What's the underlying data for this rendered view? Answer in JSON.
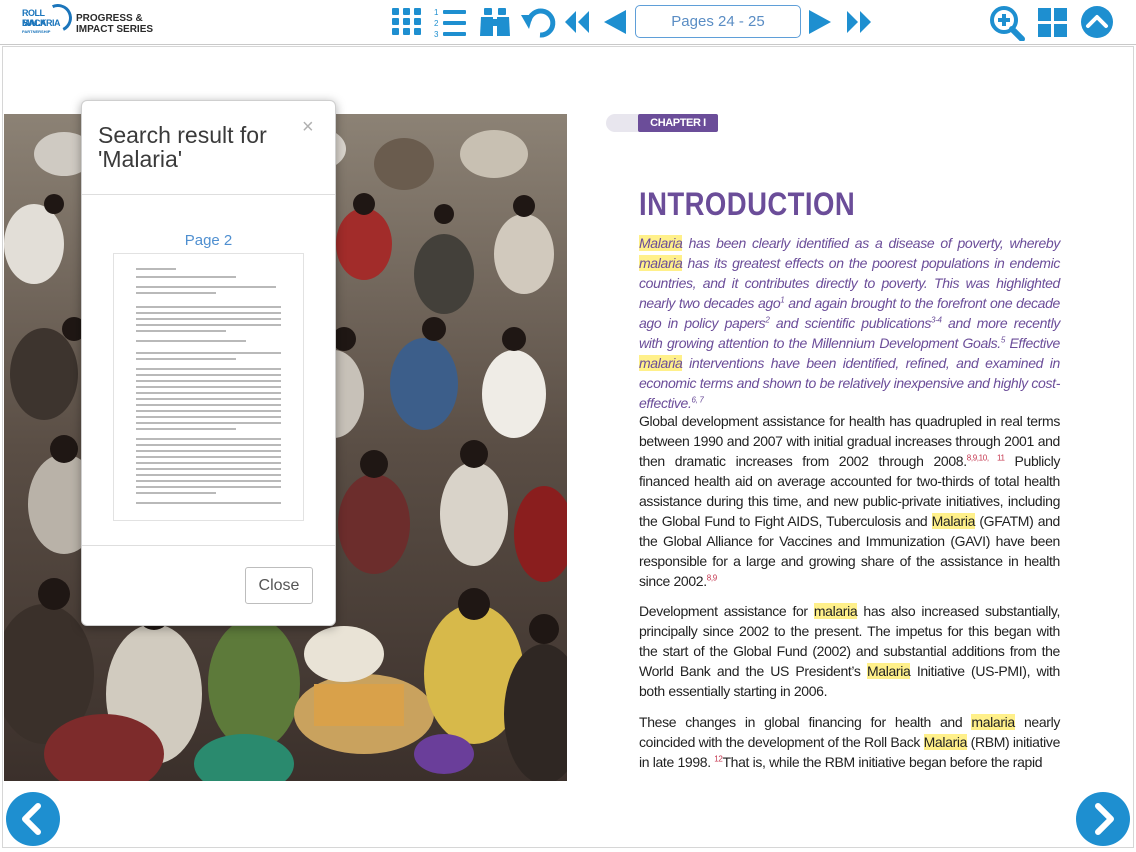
{
  "toolbar": {
    "logo_line1": "ROLL BACK",
    "logo_line2": "MALARIA",
    "logo_line3": "PARTNERSHIP",
    "series_title_1": "PROGRESS &",
    "series_title_2": "IMPACT SERIES",
    "page_indicator": "Pages 24 - 25",
    "icon_color": "#1e8fd0"
  },
  "search_popup": {
    "title": "Search result for 'Malaria'",
    "close_symbol": "×",
    "result_page": "Page 2",
    "close_button": "Close"
  },
  "page": {
    "chapter_label": "CHAPTER I",
    "heading": "INTRODUCTION",
    "accent_color": "#6b4d99",
    "highlight_color": "#fff08a"
  },
  "intro_italic": {
    "t1": "Malaria",
    "t2": " has been clearly identified as a disease of poverty, whereby ",
    "t3": "malaria",
    "t4": " has its greatest effects on the poorest populations in endemic countries, and it contributes directly to poverty. This was highlighted nearly two decades ago",
    "r1": "1",
    "t5": " and again brought to the forefront one decade ago in policy papers",
    "r2": "2",
    "t6": " and scientific publications",
    "r3": "3-4",
    "t7": " and more recently with growing attention to the Millennium Development Goals.",
    "r4": "5",
    "t8": " Effective ",
    "t9": "malaria",
    "t10": " interventions have been identified, refined, and examined in economic terms and shown to be relatively inexpensive and highly cost-effective.",
    "r5": "6, 7"
  },
  "para1": {
    "t1": "Global development assistance for health has quadrupled in real terms between 1990 and 2007 with initial gradual increases through 2001 and then dramatic increases from 2002 through 2008.",
    "r1": "8,9,10, 11",
    "t2": " Publicly financed health aid on average accounted for two-thirds of total health assistance during this time, and new public-private initiatives, including the Global Fund to Fight AIDS, Tuberculosis and ",
    "t3": "Malaria",
    "t4": " (GFATM) and the Global Alliance for Vaccines and Immunization (GAVI) have been responsible for a large and growing share of the assistance in health since 2002.",
    "r2": "8,9"
  },
  "para2": {
    "t1": "Development assistance for ",
    "t2": "malaria",
    "t3": " has also increased substantially, principally since 2002 to the present. The impetus for this began with the start of the Global Fund (2002) and substantial additions from the World Bank and the US President’s ",
    "t4": "Malaria",
    "t5": " Initiative (US-PMI), with both essentially starting in 2006."
  },
  "para3": {
    "t1": "These changes in global financing for health and ",
    "t2": "malaria",
    "t3": " nearly coincided with the development of the Roll Back ",
    "t4": "Malaria",
    "t5": " (RBM) initiative in late 1998. ",
    "r1": "12",
    "t6": "That is, while the RBM initiative began before the rapid"
  }
}
